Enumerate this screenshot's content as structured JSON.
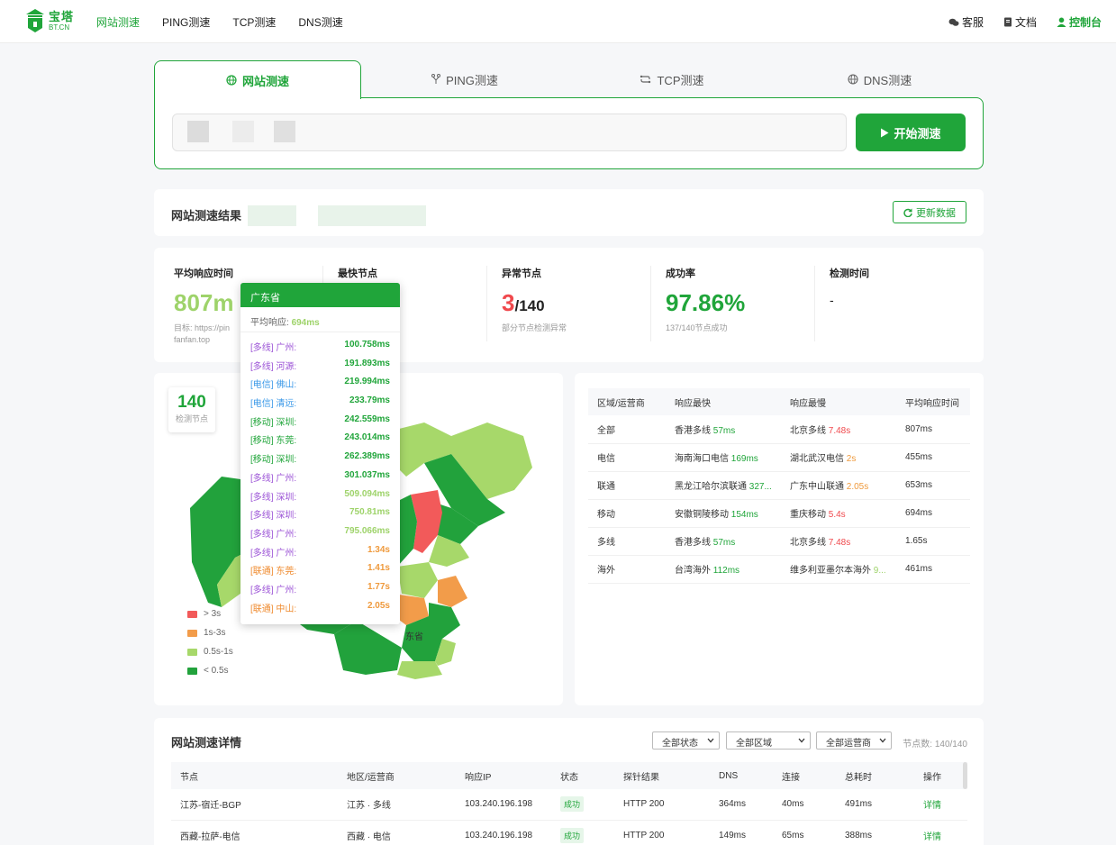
{
  "nav": {
    "logo_cn": "宝塔",
    "logo_en": "BT.CN",
    "links": [
      "网站测速",
      "PING测速",
      "TCP测速",
      "DNS测速"
    ],
    "right": [
      "客服",
      "文档",
      "控制台"
    ]
  },
  "tabs": [
    "网站测速",
    "PING测速",
    "TCP测速",
    "DNS测速"
  ],
  "search": {
    "button": "开始测速"
  },
  "result": {
    "title": "网站测速结果",
    "refresh": "更新数据"
  },
  "stats": {
    "avg_label": "平均响应时间",
    "avg_value": "807m",
    "avg_sub1": "目标: https://pin",
    "avg_sub2": "fanfan.top",
    "fast_label": "最快节点",
    "abn_label": "异常节点",
    "abn_value": "3",
    "abn_total": "/140",
    "abn_sub": "部分节点检测异常",
    "rate_label": "成功率",
    "rate_value": "97.86%",
    "rate_sub": "137/140节点成功",
    "time_label": "检测时间",
    "time_value": "-"
  },
  "map": {
    "node_count": "140",
    "node_label": "检测节点",
    "region_label": "东省",
    "legend": [
      {
        "label": "> 3s",
        "color": "#f25a5a"
      },
      {
        "label": "1s-3s",
        "color": "#f29c4a"
      },
      {
        "label": "0.5s-1s",
        "color": "#a7d86a"
      },
      {
        "label": "< 0.5s",
        "color": "#22a23c"
      }
    ]
  },
  "tooltip": {
    "province": "广东省",
    "avg_label": "平均响应:",
    "avg_value": "694ms",
    "rows": [
      {
        "name": "[多线] 广州:",
        "value": "100.758ms",
        "isp": "multi",
        "level": "green"
      },
      {
        "name": "[多线] 河源:",
        "value": "191.893ms",
        "isp": "multi",
        "level": "green"
      },
      {
        "name": "[电信] 佛山:",
        "value": "219.994ms",
        "isp": "tel",
        "level": "green"
      },
      {
        "name": "[电信] 清远:",
        "value": "233.79ms",
        "isp": "tel",
        "level": "green"
      },
      {
        "name": "[移动] 深圳:",
        "value": "242.559ms",
        "isp": "mob",
        "level": "green"
      },
      {
        "name": "[移动] 东莞:",
        "value": "243.014ms",
        "isp": "mob",
        "level": "green"
      },
      {
        "name": "[移动] 深圳:",
        "value": "262.389ms",
        "isp": "mob",
        "level": "green"
      },
      {
        "name": "[多线] 广州:",
        "value": "301.037ms",
        "isp": "multi",
        "level": "green"
      },
      {
        "name": "[多线] 深圳:",
        "value": "509.094ms",
        "isp": "multi",
        "level": "lgreen"
      },
      {
        "name": "[多线] 深圳:",
        "value": "750.81ms",
        "isp": "multi",
        "level": "lgreen"
      },
      {
        "name": "[多线] 广州:",
        "value": "795.066ms",
        "isp": "multi",
        "level": "lgreen"
      },
      {
        "name": "[多线] 广州:",
        "value": "1.34s",
        "isp": "multi",
        "level": "orange"
      },
      {
        "name": "[联通] 东莞:",
        "value": "1.41s",
        "isp": "uni",
        "level": "orange"
      },
      {
        "name": "[多线] 广州:",
        "value": "1.77s",
        "isp": "multi",
        "level": "orange"
      },
      {
        "name": "[联通] 中山:",
        "value": "2.05s",
        "isp": "uni",
        "level": "orange"
      }
    ]
  },
  "region_table": {
    "headers": [
      "区域/运营商",
      "响应最快",
      "响应最慢",
      "平均响应时间"
    ],
    "rows": [
      {
        "region": "全部",
        "fast_name": "香港多线",
        "fast_val": "57ms",
        "fast_cls": "g",
        "slow_name": "北京多线",
        "slow_val": "7.48s",
        "slow_cls": "r",
        "avg": "807ms",
        "avg_cls": "lg"
      },
      {
        "region": "电信",
        "fast_name": "海南海口电信",
        "fast_val": "169ms",
        "fast_cls": "g",
        "slow_name": "湖北武汉电信",
        "slow_val": "2s",
        "slow_cls": "o",
        "avg": "455ms",
        "avg_cls": "g"
      },
      {
        "region": "联通",
        "fast_name": "黑龙江哈尔滨联通",
        "fast_val": "327...",
        "fast_cls": "g",
        "slow_name": "广东中山联通",
        "slow_val": "2.05s",
        "slow_cls": "o",
        "avg": "653ms",
        "avg_cls": "lg"
      },
      {
        "region": "移动",
        "fast_name": "安徽铜陵移动",
        "fast_val": "154ms",
        "fast_cls": "g",
        "slow_name": "重庆移动",
        "slow_val": "5.4s",
        "slow_cls": "r",
        "avg": "694ms",
        "avg_cls": "lg"
      },
      {
        "region": "多线",
        "fast_name": "香港多线",
        "fast_val": "57ms",
        "fast_cls": "g",
        "slow_name": "北京多线",
        "slow_val": "7.48s",
        "slow_cls": "r",
        "avg": "1.65s",
        "avg_cls": "o"
      },
      {
        "region": "海外",
        "fast_name": "台湾海外",
        "fast_val": "112ms",
        "fast_cls": "g",
        "slow_name": "维多利亚墨尔本海外",
        "slow_val": "9...",
        "slow_cls": "lg",
        "avg": "461ms",
        "avg_cls": "g"
      }
    ]
  },
  "detail": {
    "title": "网站测速详情",
    "filters": [
      "全部状态",
      "全部区域",
      "全部运营商"
    ],
    "node_count": "节点数: 140/140",
    "headers": [
      "节点",
      "地区/运营商",
      "响应IP",
      "状态",
      "探针结果",
      "DNS",
      "连接",
      "总耗时",
      "操作"
    ],
    "rows": [
      {
        "node": "江苏-宿迁-BGP",
        "region": "江苏 · 多线",
        "ip": "103.240.196.198",
        "status": "成功",
        "probe": "HTTP 200",
        "dns": "364ms",
        "conn": "40ms",
        "total": "491ms",
        "action": "详情"
      },
      {
        "node": "西藏-拉萨-电信",
        "region": "西藏 · 电信",
        "ip": "103.240.196.198",
        "status": "成功",
        "probe": "HTTP 200",
        "dns": "149ms",
        "conn": "65ms",
        "total": "388ms",
        "action": "详情"
      }
    ]
  }
}
